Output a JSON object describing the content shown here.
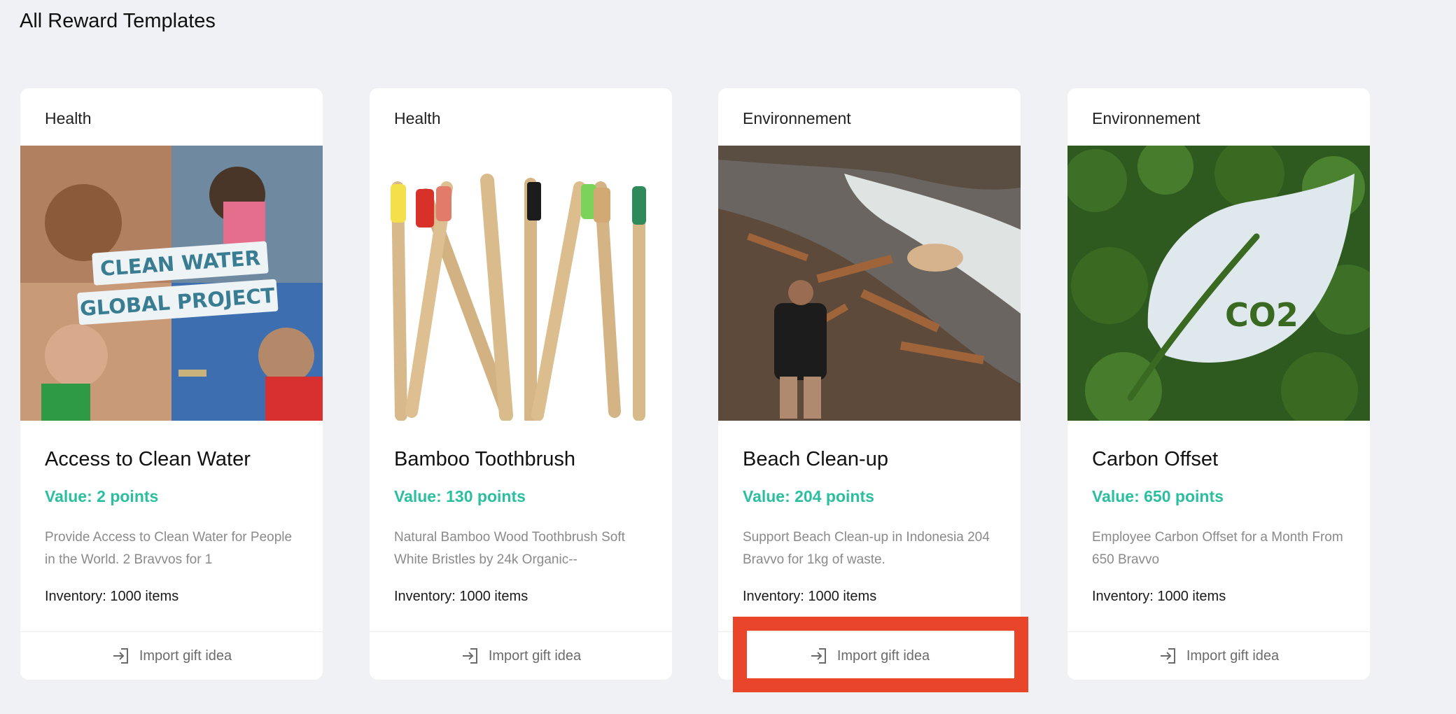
{
  "page": {
    "title": "All Reward Templates"
  },
  "cards": [
    {
      "category": "Health",
      "name": "Access to Clean Water",
      "value": "Value: 2 points",
      "description": "Provide Access to Clean Water for People in the World. 2 Bravvos for 1",
      "inventory": "Inventory: 1000 items",
      "action": "Import gift idea",
      "image_text": [
        "CLEAN WATER",
        "GLOBAL PROJECT"
      ]
    },
    {
      "category": "Health",
      "name": "Bamboo Toothbrush",
      "value": "Value: 130 points",
      "description": "Natural Bamboo Wood Toothbrush Soft White Bristles by 24k Organic--",
      "inventory": "Inventory: 1000 items",
      "action": "Import gift idea"
    },
    {
      "category": "Environnement",
      "name": "Beach Clean-up",
      "value": "Value: 204 points",
      "description": "Support Beach Clean-up in Indonesia 204 Bravvo for 1kg of waste.",
      "inventory": "Inventory: 1000 items",
      "action": "Import gift idea"
    },
    {
      "category": "Environnement",
      "name": "Carbon Offset",
      "value": "Value: 650 points",
      "description": "Employee Carbon Offset for a Month From 650 Bravvo",
      "inventory": "Inventory: 1000 items",
      "action": "Import gift idea",
      "image_text": [
        "CO2"
      ]
    }
  ],
  "colors": {
    "accent": "#2bbfa0",
    "highlight": "#e8452a",
    "background": "#f0f1f5"
  },
  "icons": {
    "import": "sign-in-arrow-icon"
  }
}
